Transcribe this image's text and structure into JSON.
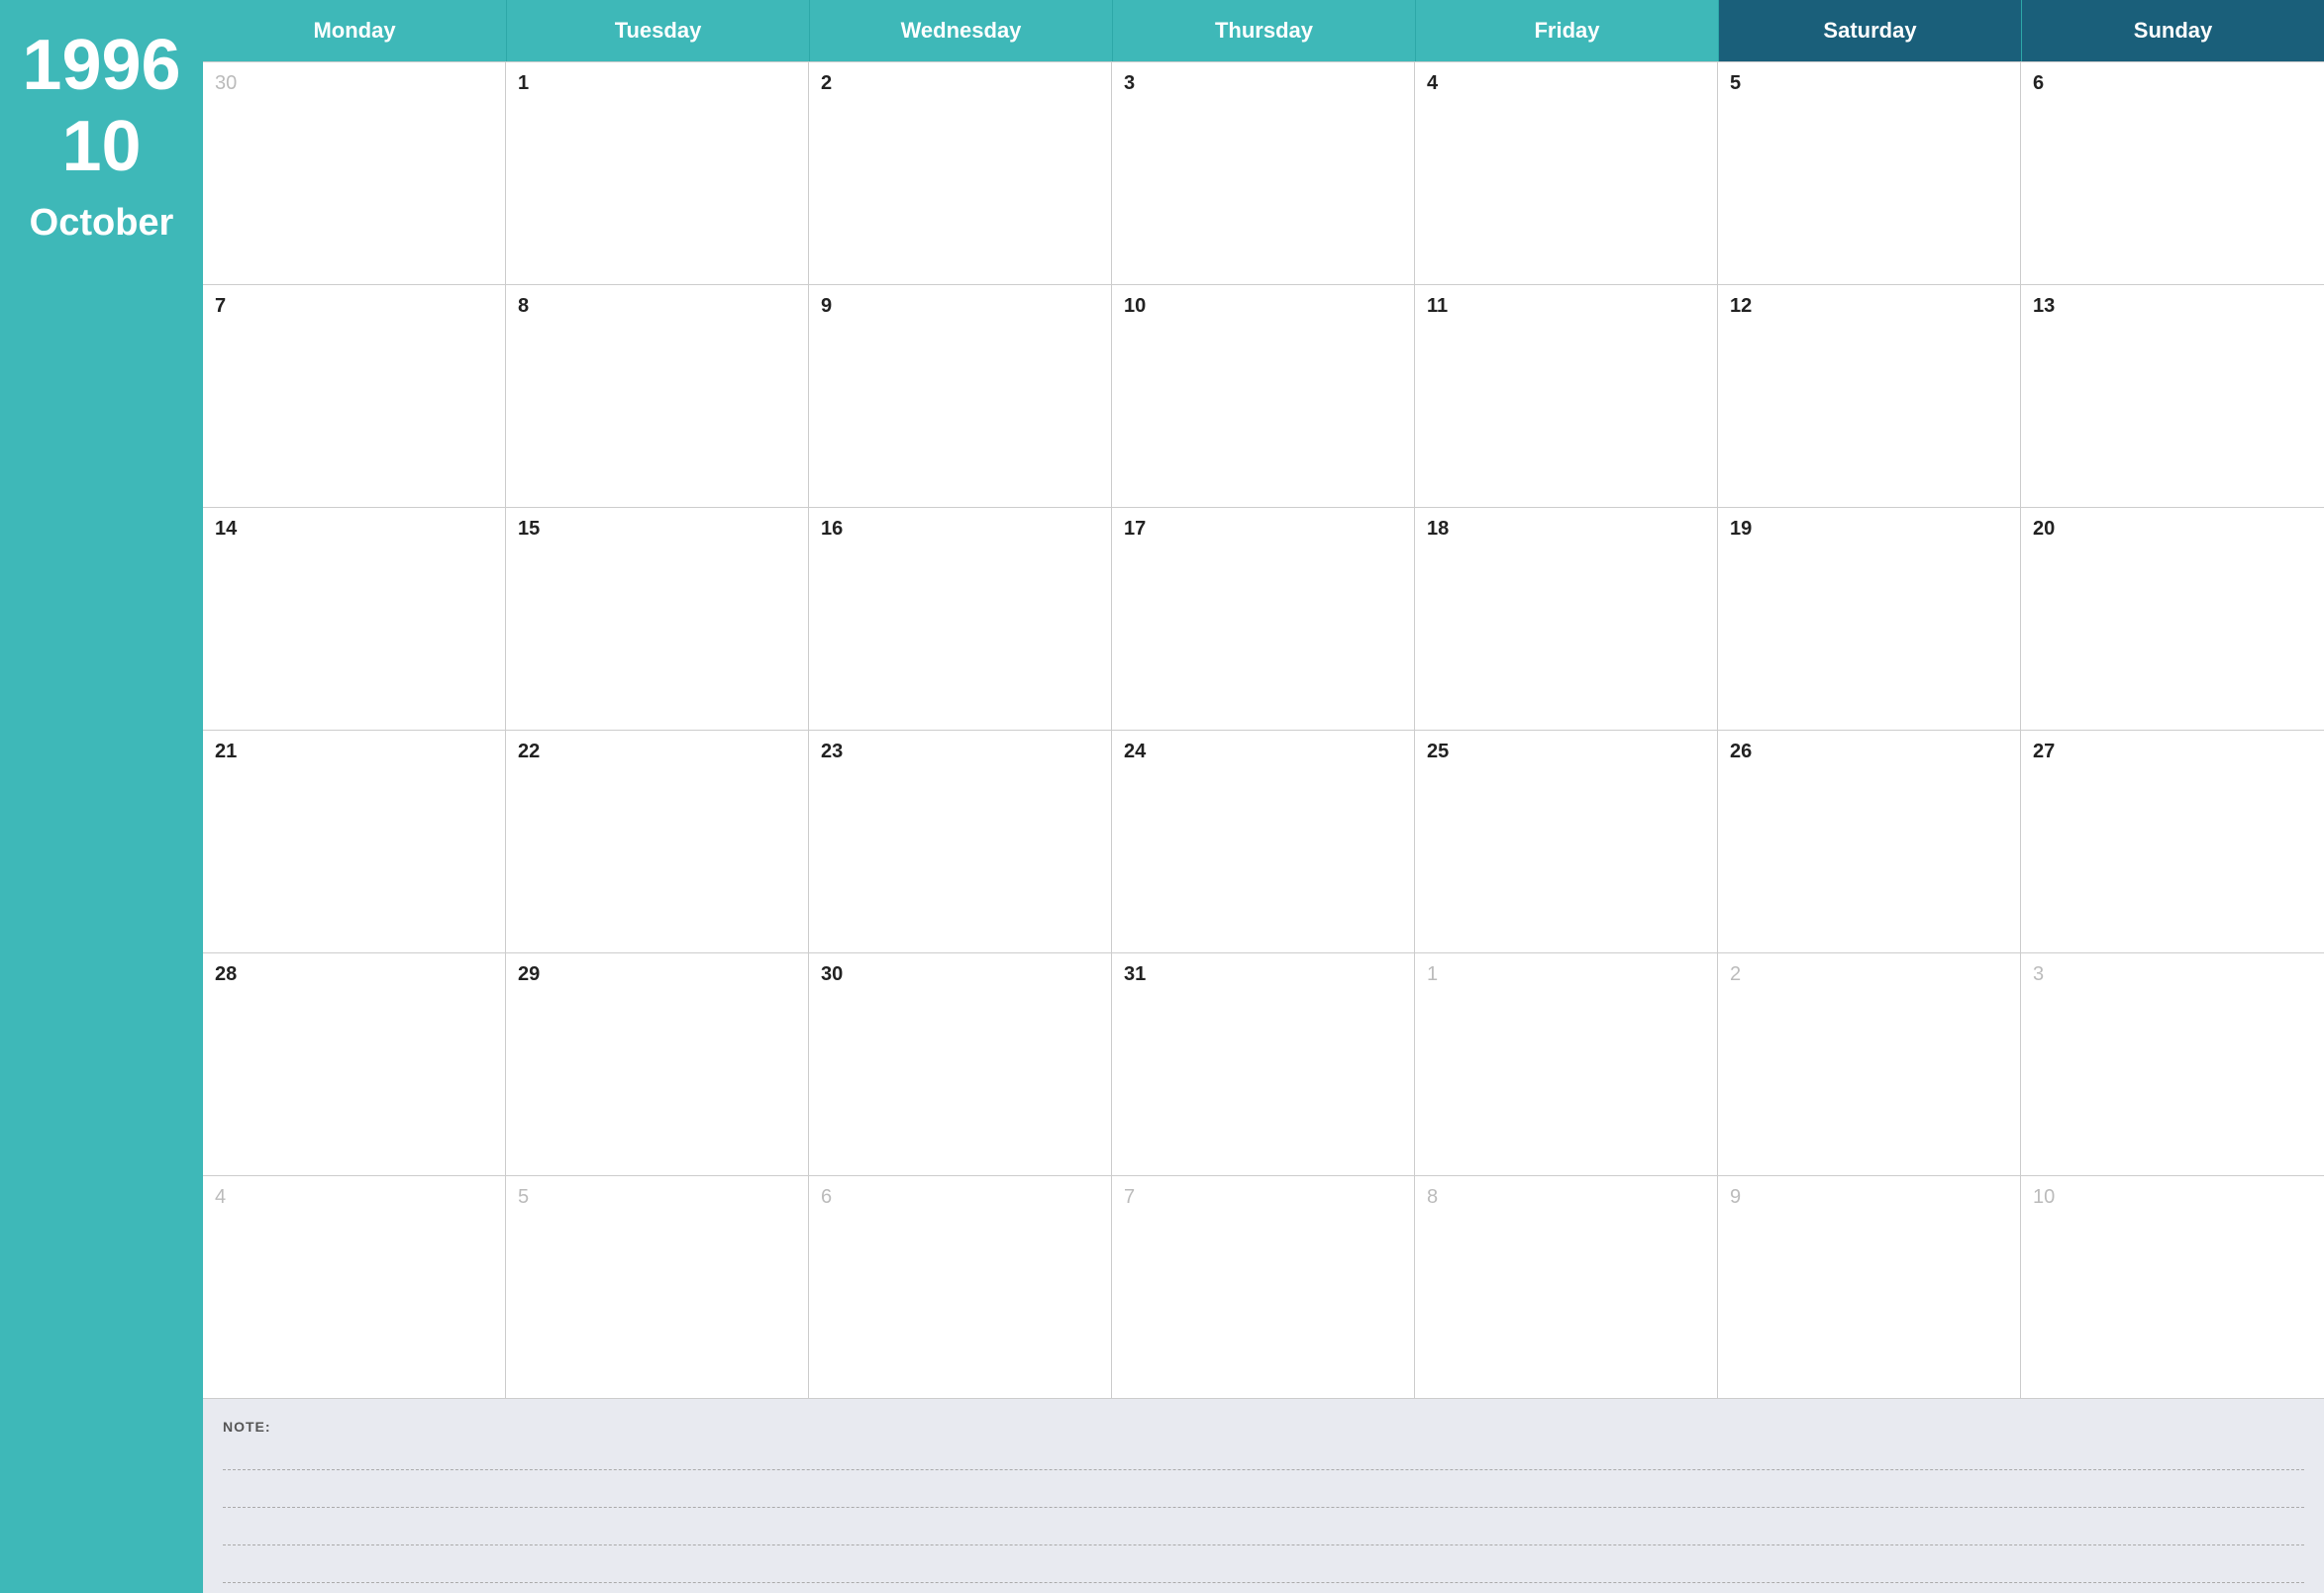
{
  "sidebar": {
    "year": "1996",
    "month_number": "10",
    "month_name": "October"
  },
  "header": {
    "days": [
      {
        "label": "Monday",
        "class": ""
      },
      {
        "label": "Tuesday",
        "class": ""
      },
      {
        "label": "Wednesday",
        "class": ""
      },
      {
        "label": "Thursday",
        "class": ""
      },
      {
        "label": "Friday",
        "class": ""
      },
      {
        "label": "Saturday",
        "class": "saturday"
      },
      {
        "label": "Sunday",
        "class": "sunday"
      }
    ]
  },
  "weeks": [
    [
      {
        "day": "30",
        "other": true
      },
      {
        "day": "1",
        "other": false
      },
      {
        "day": "2",
        "other": false
      },
      {
        "day": "3",
        "other": false
      },
      {
        "day": "4",
        "other": false
      },
      {
        "day": "5",
        "other": false
      },
      {
        "day": "6",
        "other": false
      }
    ],
    [
      {
        "day": "7",
        "other": false
      },
      {
        "day": "8",
        "other": false
      },
      {
        "day": "9",
        "other": false
      },
      {
        "day": "10",
        "other": false
      },
      {
        "day": "11",
        "other": false
      },
      {
        "day": "12",
        "other": false
      },
      {
        "day": "13",
        "other": false
      }
    ],
    [
      {
        "day": "14",
        "other": false
      },
      {
        "day": "15",
        "other": false
      },
      {
        "day": "16",
        "other": false
      },
      {
        "day": "17",
        "other": false
      },
      {
        "day": "18",
        "other": false
      },
      {
        "day": "19",
        "other": false
      },
      {
        "day": "20",
        "other": false
      }
    ],
    [
      {
        "day": "21",
        "other": false
      },
      {
        "day": "22",
        "other": false
      },
      {
        "day": "23",
        "other": false
      },
      {
        "day": "24",
        "other": false
      },
      {
        "day": "25",
        "other": false
      },
      {
        "day": "26",
        "other": false
      },
      {
        "day": "27",
        "other": false
      }
    ],
    [
      {
        "day": "28",
        "other": false
      },
      {
        "day": "29",
        "other": false
      },
      {
        "day": "30",
        "other": false
      },
      {
        "day": "31",
        "other": false
      },
      {
        "day": "1",
        "other": true
      },
      {
        "day": "2",
        "other": true
      },
      {
        "day": "3",
        "other": true
      }
    ],
    [
      {
        "day": "4",
        "other": true
      },
      {
        "day": "5",
        "other": true
      },
      {
        "day": "6",
        "other": true
      },
      {
        "day": "7",
        "other": true
      },
      {
        "day": "8",
        "other": true
      },
      {
        "day": "9",
        "other": true
      },
      {
        "day": "10",
        "other": true
      }
    ]
  ],
  "notes": {
    "label": "NOTE:",
    "lines": 4
  }
}
